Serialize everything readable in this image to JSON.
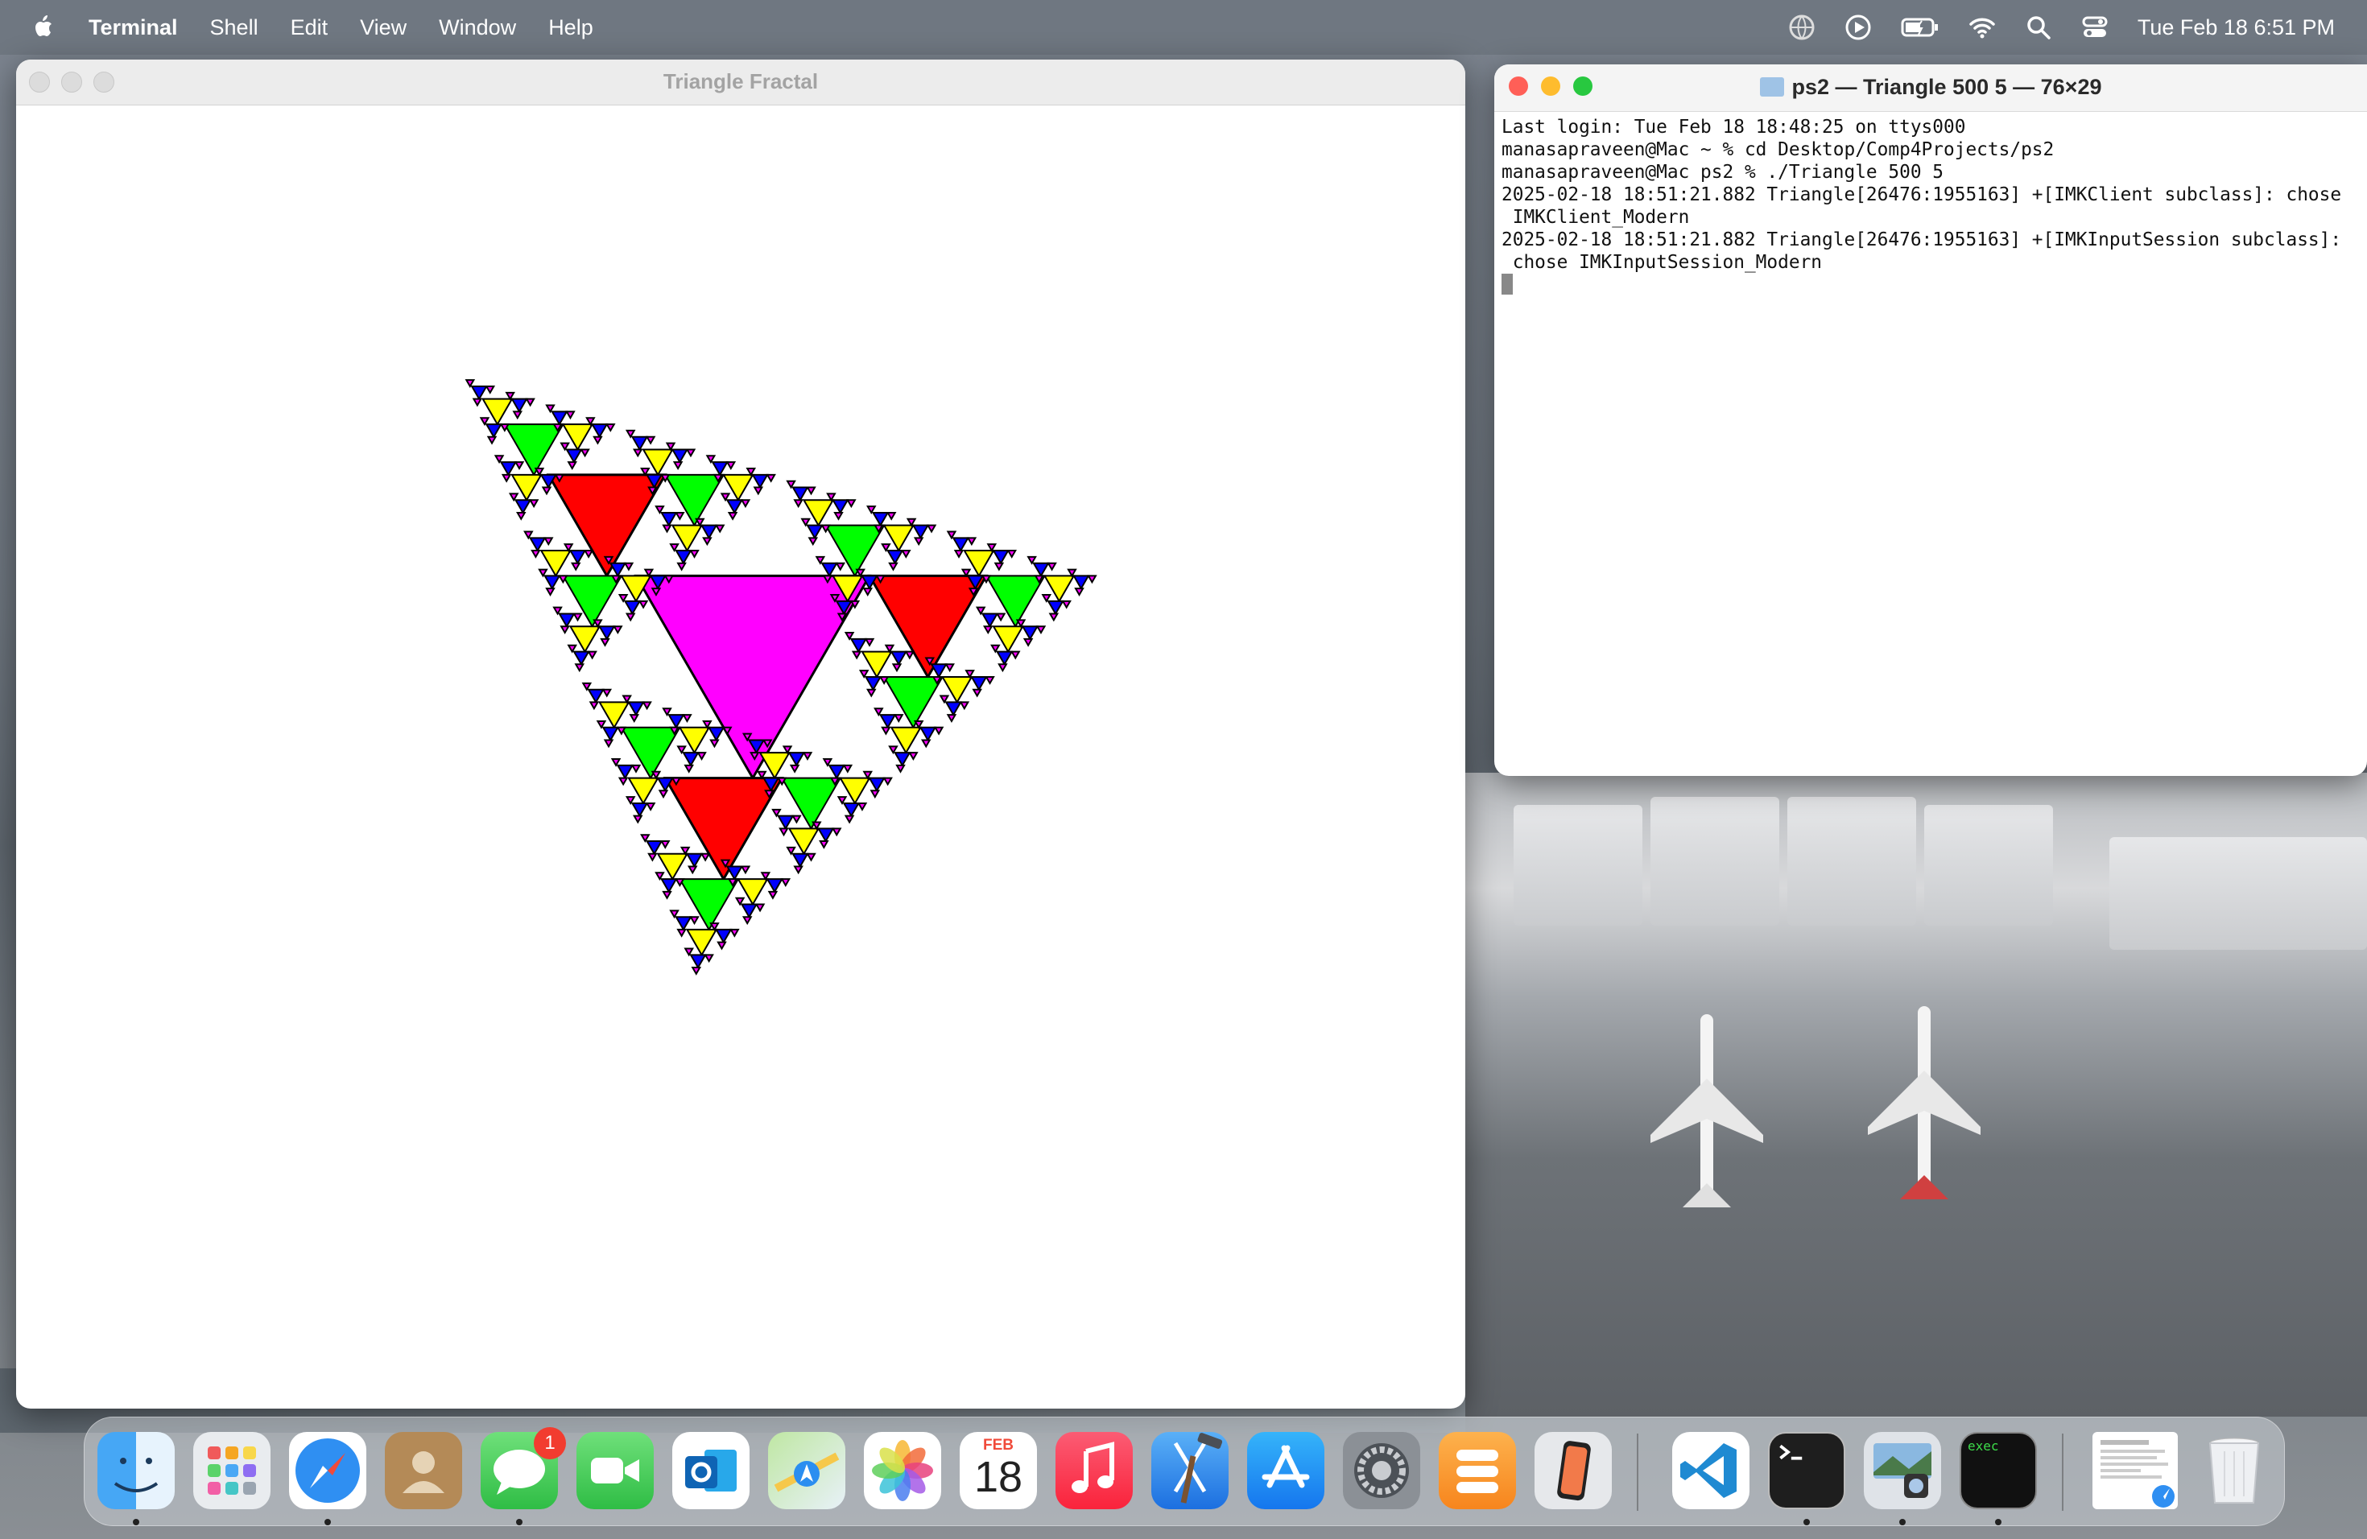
{
  "menubar": {
    "app_name": "Terminal",
    "menus": [
      "Shell",
      "Edit",
      "View",
      "Window",
      "Help"
    ],
    "datetime": "Tue Feb 18  6:51 PM"
  },
  "fractal_window": {
    "title": "Triangle Fractal",
    "colors": {
      "depth0": "#ff00ff",
      "depth1": "#ff0000",
      "depth2": "#00ff00",
      "depth3": "#ffff00",
      "depth4": "#0000ff",
      "depth5": "#ff00ff"
    }
  },
  "terminal_window": {
    "title": "ps2 — Triangle 500 5 — 76×29",
    "lines": [
      "Last login: Tue Feb 18 18:48:25 on ttys000",
      "manasapraveen@Mac ~ % cd Desktop/Comp4Projects/ps2",
      "manasapraveen@Mac ps2 % ./Triangle 500 5",
      "2025-02-18 18:51:21.882 Triangle[26476:1955163] +[IMKClient subclass]: chose",
      " IMKClient_Modern",
      "2025-02-18 18:51:21.882 Triangle[26476:1955163] +[IMKInputSession subclass]:",
      " chose IMKInputSession_Modern"
    ]
  },
  "dock": {
    "apps": [
      "Finder",
      "Launchpad",
      "Safari",
      "Contacts",
      "Messages",
      "FaceTime",
      "Outlook",
      "Maps",
      "Photos",
      "Calendar",
      "Music",
      "Xcode",
      "App Store",
      "System Settings",
      "Pages",
      "iPhone Mirroring",
      "Visual Studio Code",
      "Terminal",
      "Preview",
      "exec",
      "Document",
      "Trash"
    ],
    "calendar_month": "FEB",
    "calendar_day": "18",
    "messages_badge": "1",
    "exec_label": "exec"
  }
}
